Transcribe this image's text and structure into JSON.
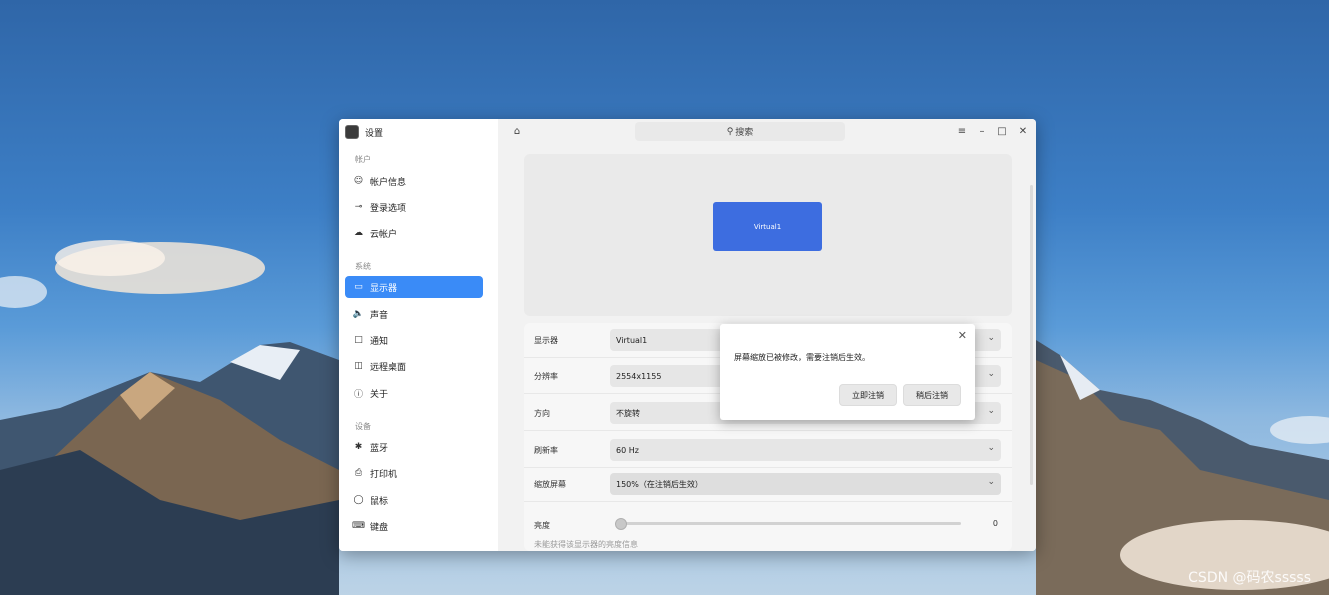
{
  "app": {
    "title": "设置"
  },
  "sidebar": {
    "groups": [
      {
        "title": "帐户",
        "items": [
          {
            "label": "帐户信息",
            "icon": "user-icon"
          },
          {
            "label": "登录选项",
            "icon": "key-icon"
          },
          {
            "label": "云帐户",
            "icon": "cloud-icon"
          }
        ]
      },
      {
        "title": "系统",
        "items": [
          {
            "label": "显示器",
            "icon": "monitor-icon",
            "active": true
          },
          {
            "label": "声音",
            "icon": "speaker-icon"
          },
          {
            "label": "通知",
            "icon": "message-icon"
          },
          {
            "label": "远程桌面",
            "icon": "remote-desktop-icon"
          },
          {
            "label": "关于",
            "icon": "info-icon"
          }
        ]
      },
      {
        "title": "设备",
        "items": [
          {
            "label": "蓝牙",
            "icon": "bluetooth-icon"
          },
          {
            "label": "打印机",
            "icon": "printer-icon"
          },
          {
            "label": "鼠标",
            "icon": "mouse-icon"
          },
          {
            "label": "键盘",
            "icon": "keyboard-icon"
          }
        ]
      }
    ]
  },
  "topbar": {
    "search_placeholder": "搜索"
  },
  "display": {
    "monitor_name": "Virtual1",
    "rows": [
      {
        "label": "显示器",
        "value": "Virtual1"
      },
      {
        "label": "分辨率",
        "value": "2554x1155"
      },
      {
        "label": "方向",
        "value": "不旋转"
      },
      {
        "label": "刷新率",
        "value": "60 Hz"
      },
      {
        "label": "缩放屏幕",
        "value": "150%（在注销后生效）"
      }
    ],
    "brightness": {
      "label": "亮度",
      "value": "0",
      "hint": "未能获得该显示器的亮度信息"
    }
  },
  "dialog": {
    "message": "屏幕缩放已被修改，需要注销后生效。",
    "logout_now": "立即注销",
    "logout_later": "稍后注销"
  },
  "watermark": "CSDN @码农sssss",
  "colors": {
    "accent": "#3a8bf7",
    "monitor": "#3d6de0"
  }
}
